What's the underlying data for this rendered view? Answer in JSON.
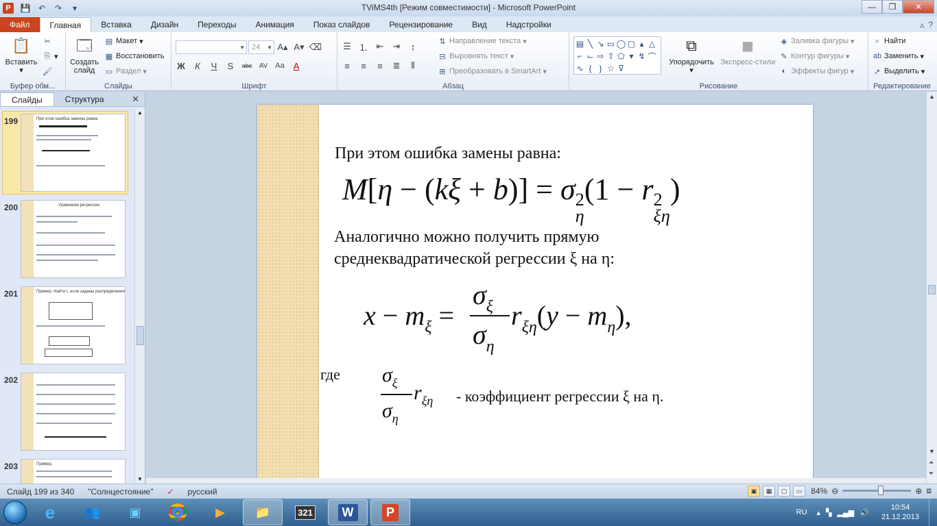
{
  "window": {
    "title": "TViMS4th [Режим совместимости]  -  Microsoft PowerPoint",
    "app_letter": "P"
  },
  "tabs": [
    "Файл",
    "Главная",
    "Вставка",
    "Дизайн",
    "Переходы",
    "Анимация",
    "Показ слайдов",
    "Рецензирование",
    "Вид",
    "Надстройки"
  ],
  "ribbon": {
    "clipboard": {
      "label": "Буфер обм...",
      "paste": "Вставить"
    },
    "slides": {
      "label": "Слайды",
      "new_slide": "Создать слайд",
      "layout": "Макет",
      "reset": "Восстановить",
      "section": "Раздел"
    },
    "font": {
      "label": "Шрифт",
      "font_name": "",
      "font_size": "24",
      "bold": "Ж",
      "italic": "К",
      "underline": "Ч",
      "strike": "S",
      "shadow": "abc",
      "spacing": "AV",
      "case": "Aa",
      "color": "A"
    },
    "paragraph": {
      "label": "Абзац",
      "text_direction": "Направление текста",
      "align_text": "Выровнять текст",
      "smartart": "Преобразовать в SmartArt"
    },
    "drawing": {
      "label": "Рисование",
      "arrange": "Упорядочить",
      "quick_styles": "Экспресс-стили",
      "fill": "Заливка фигуры",
      "outline": "Контур фигуры",
      "effects": "Эффекты фигур"
    },
    "editing": {
      "label": "Редактирование",
      "find": "Найти",
      "replace": "Заменить",
      "select": "Выделить"
    }
  },
  "left_panel": {
    "tabs": [
      "Слайды",
      "Структура"
    ],
    "slides": [
      {
        "num": "199",
        "text": "При этом ошибка замены равна"
      },
      {
        "num": "200",
        "text": "Уравнения регрессии"
      },
      {
        "num": "201",
        "text": "Пример. Найти r, если заданы распределения"
      },
      {
        "num": "202",
        "text": ""
      },
      {
        "num": "203",
        "text": "Пример."
      }
    ]
  },
  "slide": {
    "line1": "При этом ошибка замены равна:",
    "eq1": {
      "M": "M",
      "eta": "η",
      "minus": "−",
      "k": "k",
      "xi": "ξ",
      "plus": "+",
      "b": "b",
      "eq": "=",
      "sigma": "σ",
      "two": "2",
      "one": "1",
      "r": "r",
      "xieta": "ξη"
    },
    "line2": "Аналогично можно получить прямую",
    "line3": "среднеквадратической регрессии ξ на η:",
    "eq2": {
      "x": "x",
      "minus": "−",
      "m": "m",
      "xi": "ξ",
      "eq": "=",
      "sigma": "σ",
      "eta": "η",
      "r": "r",
      "xieta": "ξη",
      "y": "y"
    },
    "where": "где",
    "coef_text": "- коэффициент регрессии ξ на η."
  },
  "status": {
    "slide_info": "Слайд 199 из 340",
    "theme": "\"Солнцестояние\"",
    "language": "русский",
    "zoom": "84%"
  },
  "taskbar": {
    "lang": "RU",
    "time": "10:54",
    "date": "21.12.2013"
  }
}
